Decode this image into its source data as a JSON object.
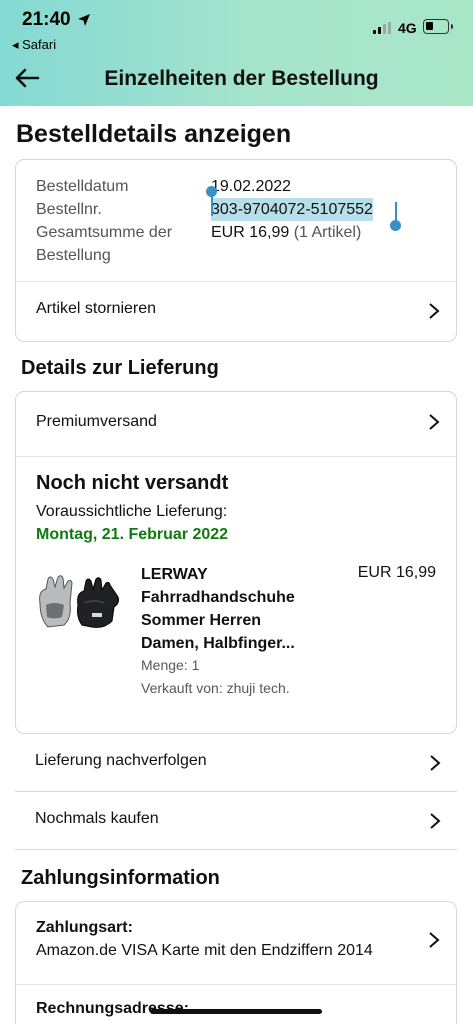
{
  "status_bar": {
    "time": "21:40",
    "back_app": "◂ Safari",
    "network": "4G"
  },
  "header": {
    "title": "Einzelheiten der Bestellung"
  },
  "order_section": {
    "heading": "Bestelldetails anzeigen",
    "date_label": "Bestelldatum",
    "date_value": "19.02.2022",
    "number_label": "Bestellnr.",
    "number_value": "303-9704072-5107552",
    "total_label_1": "Gesamtsumme der",
    "total_label_2": "Bestellung",
    "total_value": "EUR 16,99",
    "total_items": "(1 Artikel)",
    "cancel_label": "Artikel stornieren"
  },
  "delivery_section": {
    "heading": "Details zur Lieferung",
    "shipping_label": "Premiumversand",
    "status": "Noch nicht versandt",
    "expected_label": "Voraussichtliche Lieferung:",
    "expected_date": "Montag, 21. Februar 2022",
    "item": {
      "title_1": "LERWAY",
      "title_2": "Fahrradhandschuhe",
      "title_3": "Sommer Herren",
      "title_4": "Damen, Halbfinger...",
      "price": "EUR 16,99",
      "quantity": "Menge: 1",
      "seller": "Verkauft von: zhuji tech."
    },
    "track_label": "Lieferung nachverfolgen",
    "buy_again_label": "Nochmals kaufen"
  },
  "payment_section": {
    "heading": "Zahlungsinformation",
    "method_label": "Zahlungsart:",
    "method_value": "Amazon.de VISA Karte mit den Endziffern 2014",
    "billing_label": "Rechnungsadresse:"
  },
  "colors": {
    "header_gradient_start": "#84d9d3",
    "header_gradient_end": "#a9e6c8",
    "delivery_green": "#107a10",
    "selection": "#b7dfea",
    "handle": "#3a8fc4"
  }
}
